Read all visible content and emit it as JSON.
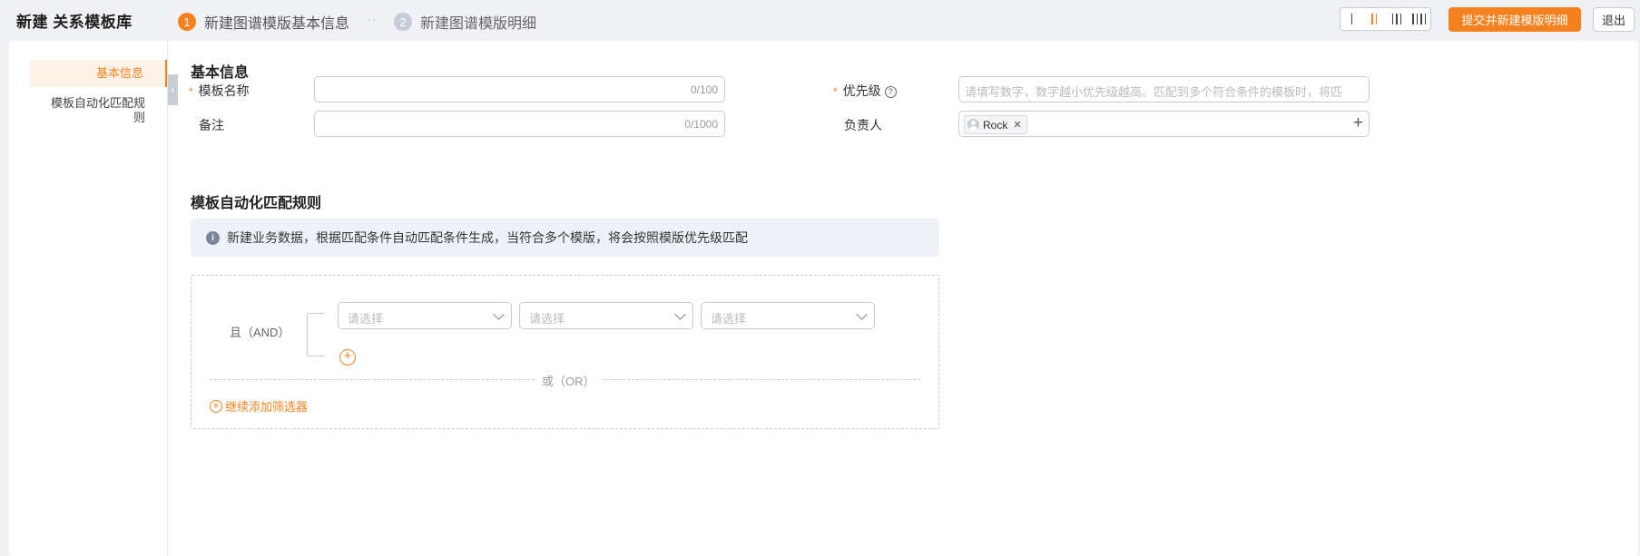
{
  "header": {
    "title": "新建 关系模板库",
    "steps": [
      {
        "num": "1",
        "label": "新建图谱模版基本信息"
      },
      {
        "num": "2",
        "label": "新建图谱模版明细"
      }
    ],
    "step_separator": "··",
    "layout_options": [
      "single-column",
      "two-column",
      "three-column",
      "four-column"
    ],
    "layout_selected": "two-column",
    "submit_label": "提交并新建模版明细",
    "exit_label": "退出"
  },
  "sidenav": {
    "items": [
      {
        "label": "基本信息",
        "active": true
      },
      {
        "label": "模板自动化匹配规则",
        "active": false
      }
    ]
  },
  "basic": {
    "section_title": "基本信息",
    "name_label": "模板名称",
    "name_value": "",
    "name_count": "0/100",
    "priority_label": "优先级",
    "priority_placeholder": "请填写数字，数字越小优先级越高。匹配到多个符合条件的模板时，将匹",
    "remark_label": "备注",
    "remark_value": "",
    "remark_count": "0/1000",
    "owner_label": "负责人",
    "owner_tag": "Rock"
  },
  "rules": {
    "section_title": "模板自动化匹配规则",
    "info_text": "新建业务数据，根据匹配条件自动匹配条件生成，当符合多个模版，将会按照模版优先级匹配",
    "and_label": "且（AND）",
    "select_placeholder": "请选择",
    "or_label": "或（OR）",
    "add_filter_label": "继续添加筛选器"
  },
  "colors": {
    "accent": "#f5821f",
    "step_inactive": "#c4cad6",
    "info_bg": "#eef2f8"
  }
}
